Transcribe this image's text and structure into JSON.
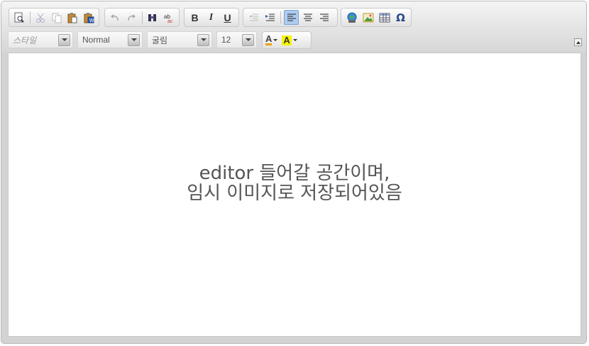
{
  "toolbar": {
    "row1": [
      {
        "group": "document",
        "buttons": [
          "preview-icon",
          "cut-icon",
          "copy-icon",
          "paste-icon",
          "paste-from-word-icon"
        ]
      },
      {
        "group": "history",
        "buttons": [
          "undo-icon",
          "redo-icon",
          "find-icon",
          "replace-icon"
        ]
      },
      {
        "group": "basicstyles",
        "buttons": [
          {
            "name": "bold",
            "label": "B"
          },
          {
            "name": "italic",
            "label": "I"
          },
          {
            "name": "underline",
            "label": "U"
          }
        ]
      },
      {
        "group": "paragraph",
        "buttons": [
          "outdent-icon",
          "indent-icon",
          "align-left-icon",
          "align-center-icon",
          "align-right-icon"
        ],
        "active": "align-left-icon"
      },
      {
        "group": "insert",
        "buttons": [
          "link-icon",
          "image-icon",
          "table-icon",
          {
            "name": "special-char",
            "label": "Ω"
          }
        ]
      }
    ],
    "bold_label": "B",
    "italic_label": "I",
    "underline_label": "U",
    "special_char_label": "Ω"
  },
  "combos": {
    "style": {
      "value": "스타일",
      "placeholder": true
    },
    "format": {
      "value": "Normal"
    },
    "font": {
      "value": "굴림"
    },
    "size": {
      "value": "12"
    }
  },
  "colors": {
    "text_color_glyph": "A",
    "bg_color_glyph": "A",
    "text_color": "#f0a000",
    "bg_color": "#f5f500",
    "active_button": "#aecbef"
  },
  "content": {
    "line1": "editor 들어갈 공간이며,",
    "line2": "임시 이미지로 저장되어있음"
  }
}
